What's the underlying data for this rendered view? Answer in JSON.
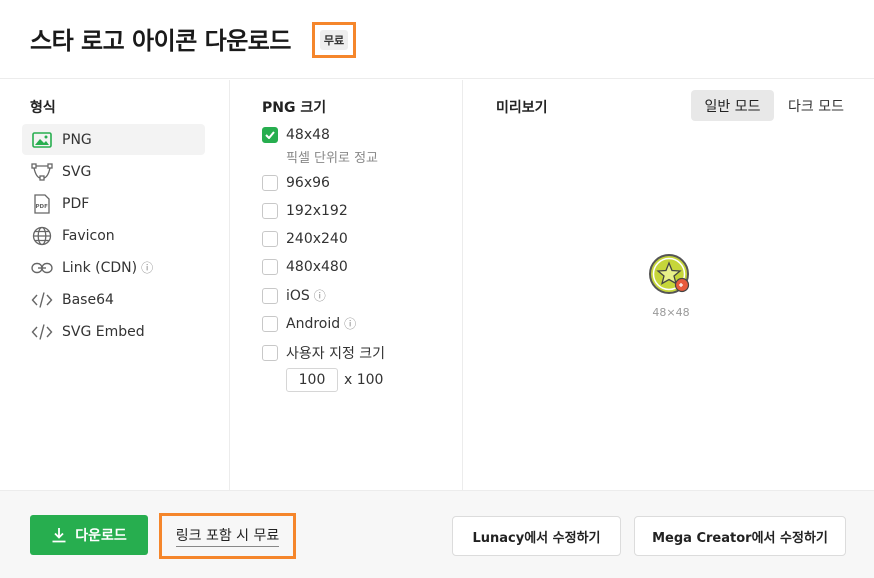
{
  "header": {
    "title": "스타 로고 아이콘 다운로드",
    "badge": "무료"
  },
  "format": {
    "title": "형식",
    "items": [
      {
        "label": "PNG",
        "icon": "image-icon",
        "active": true
      },
      {
        "label": "SVG",
        "icon": "vector-icon"
      },
      {
        "label": "PDF",
        "icon": "pdf-icon"
      },
      {
        "label": "Favicon",
        "icon": "globe-icon"
      },
      {
        "label": "Link (CDN)",
        "icon": "link-icon",
        "info": true
      },
      {
        "label": "Base64",
        "icon": "code-icon"
      },
      {
        "label": "SVG Embed",
        "icon": "code-icon"
      }
    ]
  },
  "sizes": {
    "title": "PNG 크기",
    "options": [
      {
        "label": "48x48",
        "checked": true,
        "sub": "픽셀 단위로 정교"
      },
      {
        "label": "96x96"
      },
      {
        "label": "192x192"
      },
      {
        "label": "240x240"
      },
      {
        "label": "480x480"
      },
      {
        "label": "iOS",
        "info": true
      },
      {
        "label": "Android",
        "info": true
      },
      {
        "label": "사용자 지정 크기"
      }
    ],
    "custom_width": "100",
    "custom_height_text": "x 100"
  },
  "preview": {
    "title": "미리보기",
    "light_mode": "일반 모드",
    "dark_mode": "다크 모드",
    "size_label": "48×48"
  },
  "footer": {
    "download_label": "다운로드",
    "link_free_label": "링크 포함 시 무료",
    "lunacy_label": "Lunacy에서 수정하기",
    "mega_label": "Mega Creator에서 수정하기"
  },
  "colors": {
    "accent": "#27ae4f",
    "highlight": "#f5862b"
  }
}
